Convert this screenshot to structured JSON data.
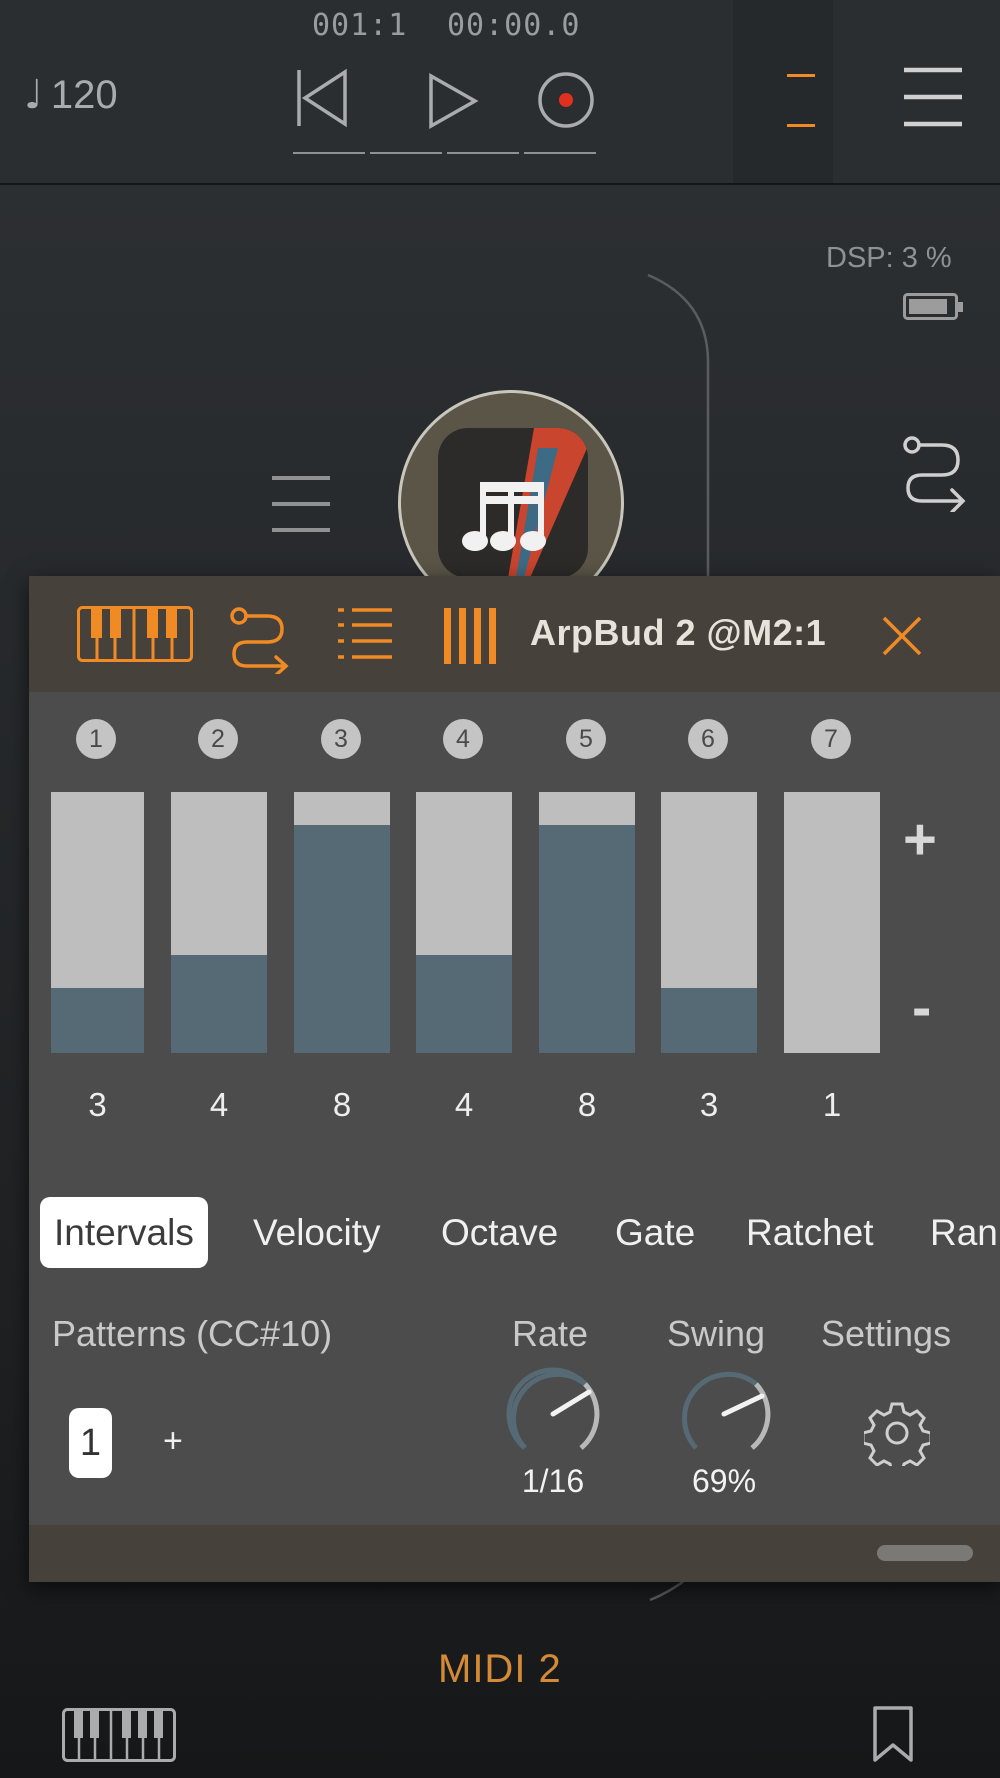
{
  "transport": {
    "position": "001:1",
    "time": "00:00.0",
    "tempo_symbol": "♩",
    "tempo": "120",
    "indicator_colors": {
      "accent": "#f08a24",
      "record": "#e0301e"
    }
  },
  "status": {
    "dsp": "DSP: 3 %"
  },
  "panel": {
    "title": "ArpBud 2 @M2:1",
    "steps": [
      {
        "number": "1",
        "value": "3",
        "level": 3
      },
      {
        "number": "2",
        "value": "4",
        "level": 4
      },
      {
        "number": "3",
        "value": "8",
        "level": 8
      },
      {
        "number": "4",
        "value": "4",
        "level": 4
      },
      {
        "number": "5",
        "value": "8",
        "level": 8
      },
      {
        "number": "6",
        "value": "3",
        "level": 3
      },
      {
        "number": "7",
        "value": "1",
        "level": 1
      }
    ],
    "level_max": 9,
    "plus_label": "+",
    "minus_label": "-",
    "tabs": [
      "Intervals",
      "Velocity",
      "Octave",
      "Gate",
      "Ratchet",
      "Ran"
    ],
    "active_tab": "Intervals",
    "patterns_label": "Patterns (CC#10)",
    "pattern_selected": "1",
    "pattern_add": "+",
    "rate": {
      "label": "Rate",
      "value": "1/16"
    },
    "swing": {
      "label": "Swing",
      "value": "69%"
    },
    "settings_label": "Settings"
  },
  "footer": {
    "midi_label": "MIDI 2"
  }
}
